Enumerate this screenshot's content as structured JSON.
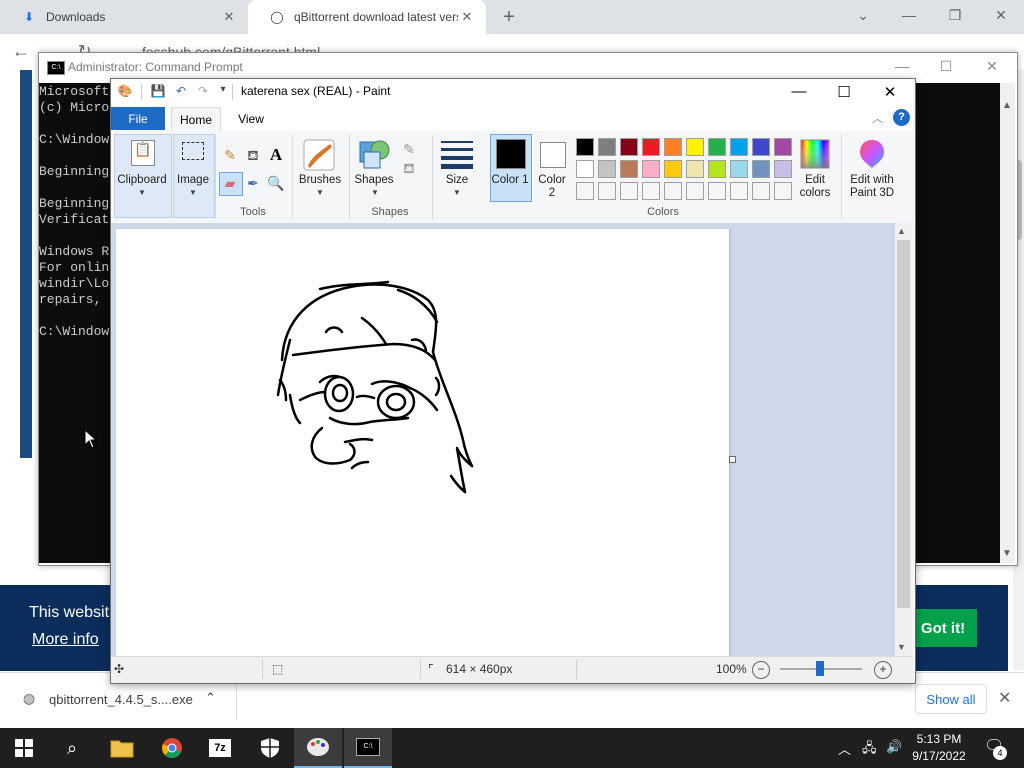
{
  "browser": {
    "tabs": [
      {
        "title": "Downloads",
        "icon": "download-icon"
      },
      {
        "title": "qBittorrent download latest versi",
        "icon": "fosshub-icon"
      }
    ],
    "url": "fosshub.com/qBittorrent.html",
    "cookie_banner": {
      "text": "This websit",
      "more_info": "More info",
      "accept": "Got it!"
    },
    "download_bar": {
      "file": "qbittorrent_4.4.5_s....exe",
      "show_all": "Show all"
    }
  },
  "cmd": {
    "title": "Administrator: Command Prompt",
    "icon_label": "C:\\",
    "lines": [
      "Microsoft",
      "(c) Micro",
      "",
      "C:\\Window",
      "",
      "Beginning",
      "",
      "Beginning",
      "Verificat",
      "",
      "Windows R",
      "For onlin",
      "windir\\Lo",
      "repairs, ",
      "",
      "C:\\Window"
    ]
  },
  "paint": {
    "title": "katerena sex (REAL) - Paint",
    "tabs": {
      "file": "File",
      "home": "Home",
      "view": "View"
    },
    "groups": {
      "tools": "Tools",
      "shapes": "Shapes",
      "colors": "Colors"
    },
    "buttons": {
      "clipboard": "Clipboard",
      "image": "Image",
      "brushes": "Brushes",
      "shapes": "Shapes",
      "size": "Size",
      "color1": "Color 1",
      "color2": "Color 2",
      "edit_colors": "Edit colors",
      "edit_paint3d": "Edit with Paint 3D"
    },
    "palette": [
      [
        "#000000",
        "#7f7f7f",
        "#880015",
        "#ed1c24",
        "#ff7f27",
        "#fff200",
        "#22b14c",
        "#00a2e8",
        "#3f48cc",
        "#a349a4"
      ],
      [
        "#ffffff",
        "#c3c3c3",
        "#b97a57",
        "#ffaec9",
        "#ffc90e",
        "#efe4b0",
        "#b5e61d",
        "#99d9ea",
        "#7092be",
        "#c8bfe7"
      ],
      [
        "#f5f6f7",
        "#f5f6f7",
        "#f5f6f7",
        "#f5f6f7",
        "#f5f6f7",
        "#f5f6f7",
        "#f5f6f7",
        "#f5f6f7",
        "#f5f6f7",
        "#f5f6f7"
      ]
    ],
    "status": {
      "dimensions": "614 × 460px",
      "zoom": "100%"
    }
  },
  "taskbar": {
    "time": "5:13 PM",
    "date": "9/17/2022",
    "notifications": "4"
  }
}
